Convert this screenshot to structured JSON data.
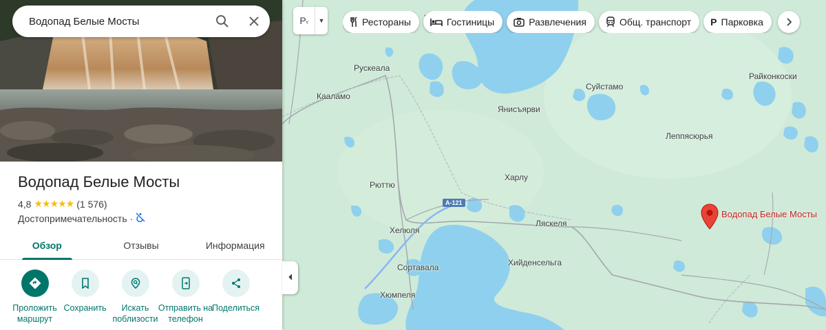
{
  "search": {
    "query": "Водопад Белые Мосты"
  },
  "place": {
    "title": "Водопад Белые Мосты",
    "rating": "4,8",
    "review_count": "(1 576)",
    "category": "Достопримечательность",
    "category_separator": "·"
  },
  "tabs": [
    {
      "label": "Обзор",
      "active": true
    },
    {
      "label": "Отзывы",
      "active": false
    },
    {
      "label": "Информация",
      "active": false
    }
  ],
  "actions": [
    {
      "label": "Проложить маршрут",
      "icon": "directions-icon"
    },
    {
      "label": "Сохранить",
      "icon": "bookmark-icon"
    },
    {
      "label": "Искать поблизости",
      "icon": "nearby-icon"
    },
    {
      "label": "Отправить на телефон",
      "icon": "send-to-phone-icon"
    },
    {
      "label": "Поделиться",
      "icon": "share-icon"
    }
  ],
  "layers_button": {
    "label": "Р"
  },
  "chips": [
    {
      "label": "Рестораны",
      "icon": "restaurant-icon"
    },
    {
      "label": "Гостиницы",
      "icon": "hotel-icon"
    },
    {
      "label": "Развлечения",
      "icon": "camera-icon"
    },
    {
      "label": "Общ. транспорт",
      "icon": "transit-icon"
    },
    {
      "label": "Парковка",
      "icon": "parking-icon"
    }
  ],
  "map": {
    "towns": [
      "Рускеала",
      "Кааламо",
      "Янисъярви",
      "Суйстамо",
      "Райконкоски",
      "Леппясюрья",
      "Харлу",
      "Рюттю",
      "Хелюля",
      "Ляскеля",
      "Сортавала",
      "Хийденсельга",
      "Хюмпеля"
    ],
    "road_label": "А-121",
    "pin_label": "Водопад Белые Мосты",
    "partial_label": "К"
  },
  "colors": {
    "accent": "#00766b",
    "land": "#cfead8",
    "water": "#8fd0ee",
    "pin": "#ea4335",
    "pin_label": "#c5221f"
  }
}
